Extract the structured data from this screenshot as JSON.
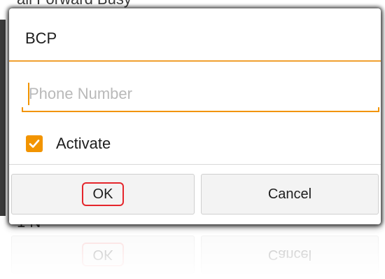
{
  "background": {
    "title_fragment": "all Forward Busy",
    "under_fragment": "1  N"
  },
  "dialog": {
    "title": "BCP",
    "phone_field": {
      "placeholder": "Phone Number",
      "value": ""
    },
    "activate": {
      "label": "Activate",
      "checked": true
    },
    "buttons": {
      "ok_label": "OK",
      "cancel_label": "Cancel"
    }
  },
  "colors": {
    "accent": "#f29400",
    "highlight": "#e5262c"
  }
}
